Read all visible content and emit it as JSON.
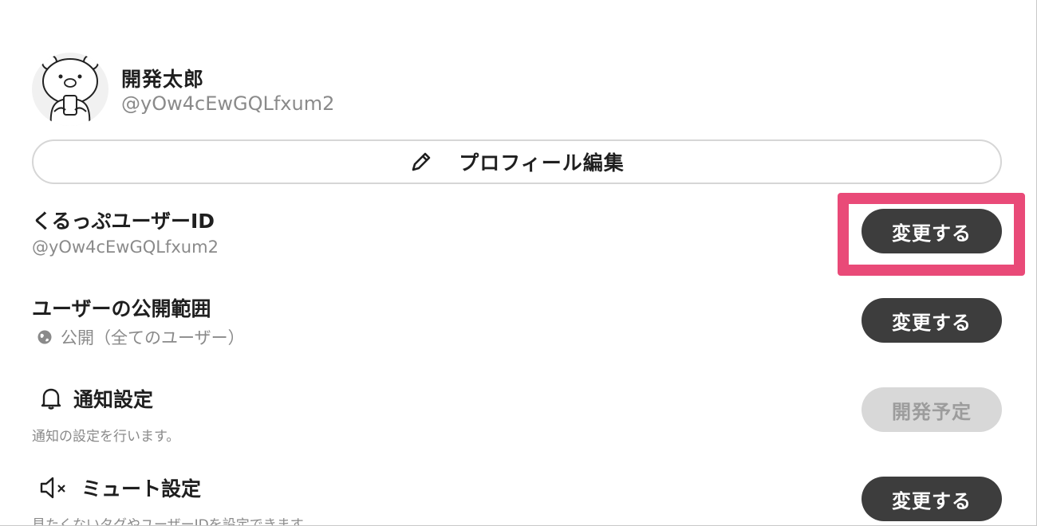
{
  "profile": {
    "name": "開発太郎",
    "handle": "@yOw4cEwGQLfxum2",
    "edit_button_label": "プロフィール編集"
  },
  "settings": {
    "user_id": {
      "title": "くるっぷユーザーID",
      "value": "@yOw4cEwGQLfxum2",
      "button_label": "変更する"
    },
    "visibility": {
      "title": "ユーザーの公開範囲",
      "value": "公開（全てのユーザー）",
      "button_label": "変更する"
    },
    "notifications": {
      "title": "通知設定",
      "description": "通知の設定を行います。",
      "button_label": "開発予定"
    },
    "mute": {
      "title": "ミュート設定",
      "description": "見たくないタグやユーザーIDを設定できます。",
      "button_label": "変更する"
    }
  },
  "icons": {
    "edit": "pencil-icon",
    "visibility": "globe-icon",
    "notifications": "bell-icon",
    "mute": "speaker-mute-icon"
  },
  "colors": {
    "highlight": "#e94a78",
    "button": "#3d3d3d",
    "button_disabled": "#d8d8d8"
  }
}
